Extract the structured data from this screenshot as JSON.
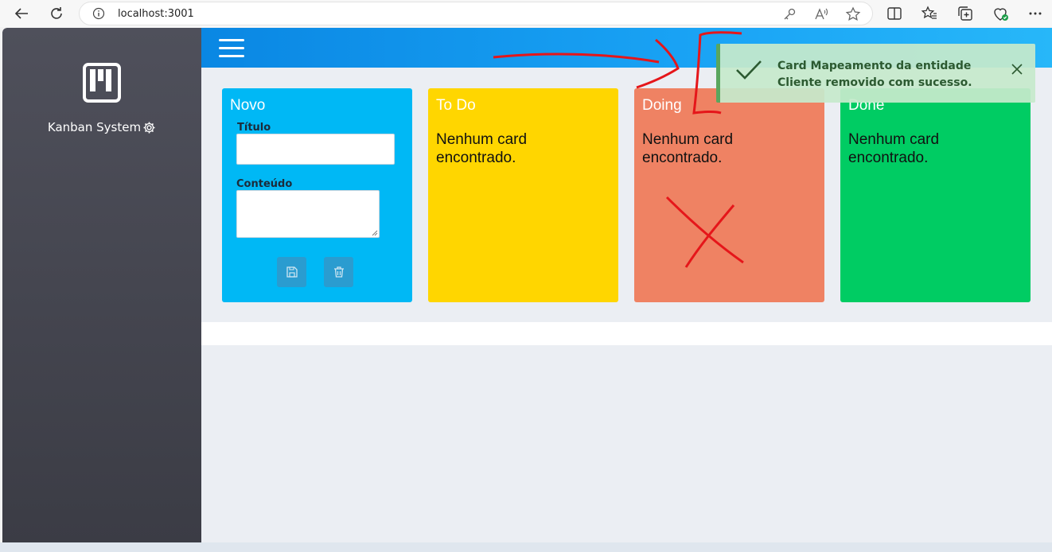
{
  "browser": {
    "url": "localhost:3001"
  },
  "sidebar": {
    "brand": "Kanban System"
  },
  "columns": [
    {
      "title": "Novo",
      "color": "#00b8f5",
      "titulo_label": "Título",
      "conteudo_label": "Conteúdo"
    },
    {
      "title": "To Do",
      "color": "#ffd600",
      "empty_text": "Nenhum card encontrado."
    },
    {
      "title": "Doing",
      "color": "#ef8263",
      "empty_text": "Nenhum card encontrado."
    },
    {
      "title": "Done",
      "color": "#00cc63",
      "empty_text": "Nenhum card encontrado."
    }
  ],
  "toast": {
    "message": "Card Mapeamento da entidade Cliente removido com sucesso.",
    "type": "success",
    "color": "#5aa65e"
  },
  "icons": [
    "back-icon",
    "refresh-icon",
    "info-icon",
    "key-icon",
    "read-aloud-icon",
    "favorite-star-icon",
    "split-screen-icon",
    "favorites-icon",
    "collections-icon",
    "browser-essentials-icon",
    "more-icon",
    "kanban-logo-icon",
    "gear-icon",
    "hamburger-icon",
    "save-icon",
    "trash-icon",
    "check-icon",
    "close-icon"
  ]
}
